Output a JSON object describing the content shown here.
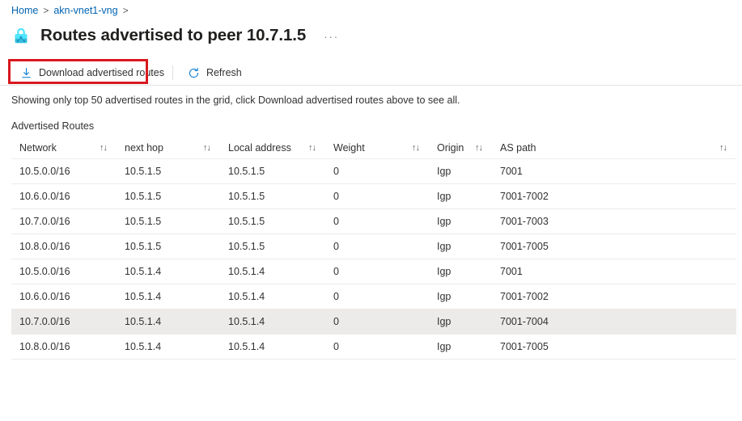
{
  "breadcrumb": {
    "items": [
      {
        "label": "Home"
      },
      {
        "label": "akn-vnet1-vng"
      }
    ],
    "separator": ">"
  },
  "header": {
    "icon": "vpn-gateway-lock-icon",
    "title": "Routes advertised to peer 10.7.1.5",
    "ellipsis": "···"
  },
  "toolbar": {
    "download_label": "Download advertised routes",
    "download_icon": "download-arrow-icon",
    "refresh_label": "Refresh",
    "refresh_icon": "refresh-circle-icon"
  },
  "annotation": {
    "color": "#d7191f",
    "target": "Download advertised routes"
  },
  "info": {
    "message": "Showing only top 50 advertised routes in the grid, click Download advertised routes above to see all."
  },
  "grid": {
    "caption": "Advertised Routes",
    "sort_icon": "↑↓",
    "columns": [
      {
        "key": "network",
        "label": "Network",
        "sortable": true
      },
      {
        "key": "next_hop",
        "label": "next hop",
        "sortable": true
      },
      {
        "key": "local_address",
        "label": "Local address",
        "sortable": true
      },
      {
        "key": "weight",
        "label": "Weight",
        "sortable": true
      },
      {
        "key": "origin",
        "label": "Origin",
        "sortable": true
      },
      {
        "key": "as_path",
        "label": "AS path",
        "sortable": true
      }
    ],
    "rows": [
      {
        "network": "10.5.0.0/16",
        "next_hop": "10.5.1.5",
        "local_address": "10.5.1.5",
        "weight": "0",
        "origin": "Igp",
        "as_path": "7001",
        "selected": false
      },
      {
        "network": "10.6.0.0/16",
        "next_hop": "10.5.1.5",
        "local_address": "10.5.1.5",
        "weight": "0",
        "origin": "Igp",
        "as_path": "7001-7002",
        "selected": false
      },
      {
        "network": "10.7.0.0/16",
        "next_hop": "10.5.1.5",
        "local_address": "10.5.1.5",
        "weight": "0",
        "origin": "Igp",
        "as_path": "7001-7003",
        "selected": false
      },
      {
        "network": "10.8.0.0/16",
        "next_hop": "10.5.1.5",
        "local_address": "10.5.1.5",
        "weight": "0",
        "origin": "Igp",
        "as_path": "7001-7005",
        "selected": false
      },
      {
        "network": "10.5.0.0/16",
        "next_hop": "10.5.1.4",
        "local_address": "10.5.1.4",
        "weight": "0",
        "origin": "Igp",
        "as_path": "7001",
        "selected": false
      },
      {
        "network": "10.6.0.0/16",
        "next_hop": "10.5.1.4",
        "local_address": "10.5.1.4",
        "weight": "0",
        "origin": "Igp",
        "as_path": "7001-7002",
        "selected": false
      },
      {
        "network": "10.7.0.0/16",
        "next_hop": "10.5.1.4",
        "local_address": "10.5.1.4",
        "weight": "0",
        "origin": "Igp",
        "as_path": "7001-7004",
        "selected": true
      },
      {
        "network": "10.8.0.0/16",
        "next_hop": "10.5.1.4",
        "local_address": "10.5.1.4",
        "weight": "0",
        "origin": "Igp",
        "as_path": "7001-7005",
        "selected": false
      }
    ]
  },
  "colors": {
    "link": "#0063b1",
    "accent": "#0078d4",
    "annotation_red": "#d7191f",
    "row_selected": "#edebe9",
    "border": "#edebe9",
    "icon_cyan": "#32bedd"
  }
}
